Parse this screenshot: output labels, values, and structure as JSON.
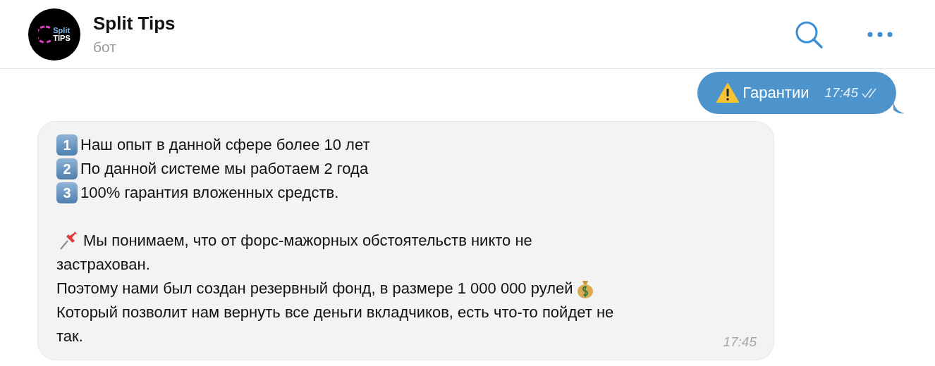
{
  "header": {
    "title": "Split Tips",
    "subtitle": "бот",
    "avatar": {
      "line1": "Split",
      "line2": "TIPS"
    }
  },
  "messages": [
    {
      "kind": "outgoing",
      "text": "Гарантии",
      "time": "17:45",
      "read": true
    },
    {
      "kind": "incoming",
      "time": "17:45",
      "lines": [
        {
          "kind": "numbered",
          "badge": "1",
          "text": "Наш опыт в данной сфере более 10 лет"
        },
        {
          "kind": "numbered",
          "badge": "2",
          "text": "По данной системе мы работаем 2 года"
        },
        {
          "kind": "numbered",
          "badge": "3",
          "text": "100% гарантия вложенных средств."
        },
        {
          "kind": "blank"
        },
        {
          "kind": "pinned",
          "text": "Мы понимаем, что от форс-мажорных обстоятельств никто не"
        },
        {
          "kind": "text",
          "text": "застрахован."
        },
        {
          "kind": "moneybag",
          "text": "Поэтому нами был создан резервный фонд, в размере 1 000 000 рулей"
        },
        {
          "kind": "text",
          "text": "Который позволит нам вернуть все деньги вкладчиков, есть что-то пойдет не"
        },
        {
          "kind": "text",
          "text": "так."
        }
      ]
    }
  ]
}
